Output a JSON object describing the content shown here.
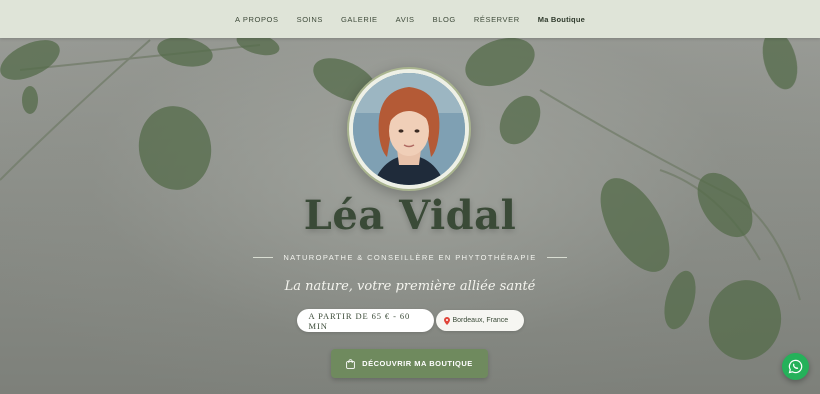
{
  "nav": {
    "items": [
      {
        "label": "A PROPOS"
      },
      {
        "label": "SOINS"
      },
      {
        "label": "GALERIE"
      },
      {
        "label": "AVIS"
      },
      {
        "label": "BLOG"
      },
      {
        "label": "RÉSERVER"
      },
      {
        "label": "Ma Boutique"
      }
    ]
  },
  "hero": {
    "name": "Léa Vidal",
    "subtitle": "NATUROPATHE & CONSEILLÈRE EN PHYTOTHÉRAPIE",
    "tagline": "La nature, votre première alliée santé",
    "price": "A PARTIR DE 65 € - 60 MIN",
    "location": "Bordeaux, France",
    "cta_label": "DÉCOUVRIR MA BOUTIQUE"
  },
  "icons": {
    "location": "map-pin-icon",
    "cta": "shopping-bag-icon",
    "chat": "whatsapp-icon"
  },
  "colors": {
    "accent": "#6f8a5e",
    "nav_bg": "#dfe4d8",
    "name_text": "#3a4a37",
    "whatsapp": "#25b15a",
    "pin": "#e0453a"
  }
}
